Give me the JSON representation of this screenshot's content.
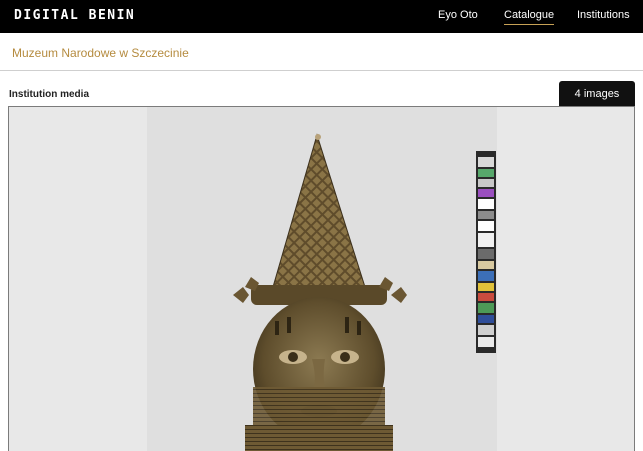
{
  "header": {
    "logo_text": "DIGITAL BENIN",
    "nav": [
      {
        "label": "Eyo Oto",
        "active": false
      },
      {
        "label": "Catalogue",
        "active": true
      },
      {
        "label": "Institutions",
        "active": false
      }
    ]
  },
  "institution": {
    "name": "Muzeum Narodowe w Szczecinie"
  },
  "media": {
    "section_title": "Institution media",
    "images_count_label": "4 images"
  },
  "colors": {
    "topbar": "#000000",
    "accent_gold": "#b58b3f",
    "tab_bg": "#111111"
  }
}
